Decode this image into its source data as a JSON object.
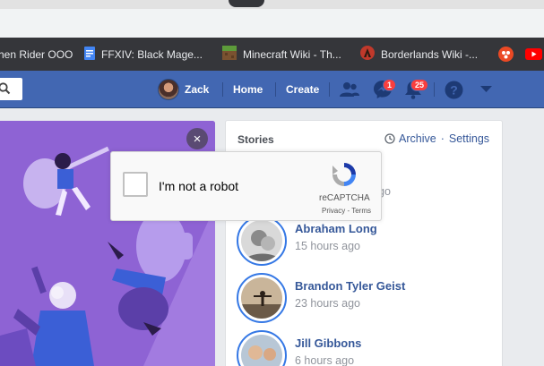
{
  "bookmarks": [
    {
      "label": "hen Rider OOO",
      "icon": "bookmark-icon"
    },
    {
      "label": "FFXIV: Black Mage...",
      "icon": "document-icon"
    },
    {
      "label": "Minecraft Wiki - Th...",
      "icon": "minecraft-icon"
    },
    {
      "label": "Borderlands Wiki -...",
      "icon": "borderlands-icon"
    }
  ],
  "nav": {
    "user": "Zack",
    "home": "Home",
    "create": "Create",
    "messages_badge": "1",
    "notifications_badge": "25"
  },
  "stories": {
    "title": "Stories",
    "archive": "Archive",
    "separator": "·",
    "settings": "Settings",
    "items": [
      {
        "name": "",
        "time": "go"
      },
      {
        "name": "Abraham Long",
        "time": "15 hours ago"
      },
      {
        "name": "Brandon Tyler Geist",
        "time": "23 hours ago"
      },
      {
        "name": "Jill Gibbons",
        "time": "6 hours ago"
      }
    ]
  },
  "captcha": {
    "label": "I'm not a robot",
    "brand": "reCAPTCHA",
    "privacy": "Privacy",
    "dash": " - ",
    "terms": "Terms"
  },
  "banner": {
    "close": "×"
  },
  "colors": {
    "fb_blue": "#4267b2",
    "banner_purple": "#8e63d4",
    "link": "#365899"
  }
}
